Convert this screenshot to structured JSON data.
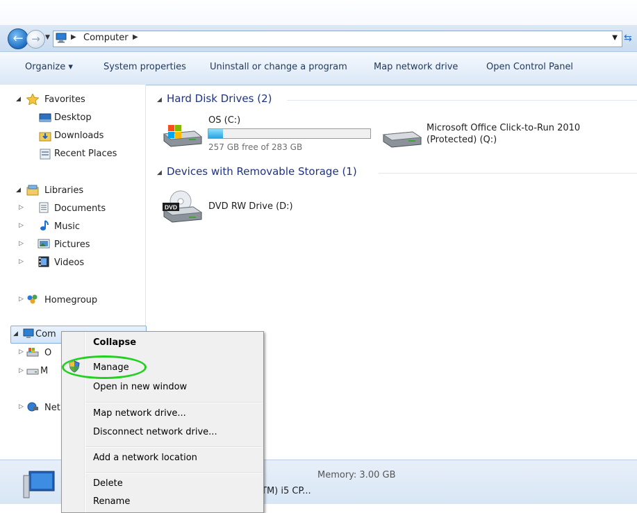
{
  "address_bar": {
    "path": [
      "Computer"
    ]
  },
  "toolbar": {
    "organize": "Organize ▾",
    "system_properties": "System properties",
    "uninstall": "Uninstall or change a program",
    "map_drive": "Map network drive",
    "control_panel": "Open Control Panel"
  },
  "nav_pane": {
    "favorites": "Favorites",
    "desktop": "Desktop",
    "downloads": "Downloads",
    "recent_places": "Recent Places",
    "libraries": "Libraries",
    "documents": "Documents",
    "music": "Music",
    "pictures": "Pictures",
    "videos": "Videos",
    "homegroup": "Homegroup",
    "computer_partial": "Com",
    "os_partial": "O",
    "m_partial": "M",
    "network_partial": "Net"
  },
  "content": {
    "hdd_group": "Hard Disk Drives (2)",
    "removable_group": "Devices with Removable Storage (1)",
    "drive_c_name": "OS (C:)",
    "drive_c_free": "257 GB free of 283 GB",
    "drive_c_used_fraction": 0.092,
    "drive_q_name_1": "Microsoft Office Click-to-Run 2010",
    "drive_q_name_2": "(Protected) (Q:)",
    "dvd_name": "DVD RW Drive (D:)",
    "dvd_badge": "DVD"
  },
  "details": {
    "memory": "Memory: 3.00 GB",
    "processor_partial": "TM) i5 CP..."
  },
  "context_menu": {
    "collapse": "Collapse",
    "manage": "Manage",
    "open_new_window": "Open in new window",
    "map_network_drive": "Map network drive...",
    "disconnect_network_drive": "Disconnect network drive...",
    "add_network_location": "Add a network location",
    "delete": "Delete",
    "rename": "Rename"
  },
  "colors": {
    "highlight_ring": "#22d020",
    "accent_blue": "#1e3287"
  }
}
